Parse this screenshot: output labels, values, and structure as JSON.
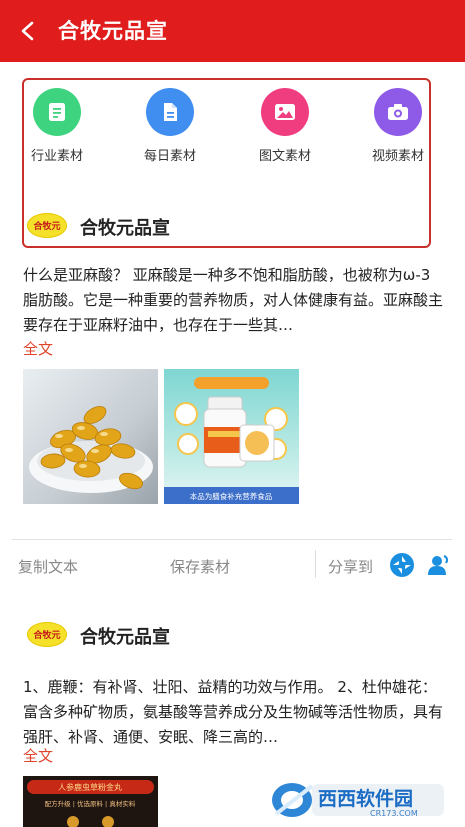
{
  "header": {
    "title": "合牧元品宣"
  },
  "categories": [
    {
      "label": "行业素材",
      "icon": "document-icon",
      "color": "#3ed47f"
    },
    {
      "label": "每日素材",
      "icon": "file-text-icon",
      "color": "#3f8ef0"
    },
    {
      "label": "图文素材",
      "icon": "image-icon",
      "color": "#ef3d80"
    },
    {
      "label": "视频素材",
      "icon": "camera-icon",
      "color": "#8d5be8"
    }
  ],
  "posts": [
    {
      "avatar_text": "合牧元",
      "name": "合牧元品宣",
      "text": "什么是亚麻酸？ 亚麻酸是一种多不饱和脂肪酸，也被称为ω-3脂肪酸。它是一种重要的营养物质，对人体健康有益。亚麻酸主要存在于亚麻籽油中，也存在于一些其…",
      "full_link": "全文",
      "image2_caption": "本品为膳食补充营养食品"
    },
    {
      "avatar_text": "合牧元",
      "name": "合牧元品宣",
      "text": "1、鹿鞭：有补肾、壮阳、益精的功效与作用。 2、杜仲雄花：富含多种矿物质，氨基酸等营养成分及生物碱等活性物质，具有强肝、补肾、通便、安眠、降三高的…",
      "full_link": "全文",
      "ad_line1": "人参鹿虫草粉金丸",
      "ad_line2": "配方升级 | 优选原料 | 真材实料"
    }
  ],
  "actions": {
    "copy": "复制文本",
    "save": "保存素材",
    "share": "分享到"
  },
  "watermark": {
    "brand": "西西软件园",
    "url": "CR173.COM"
  }
}
